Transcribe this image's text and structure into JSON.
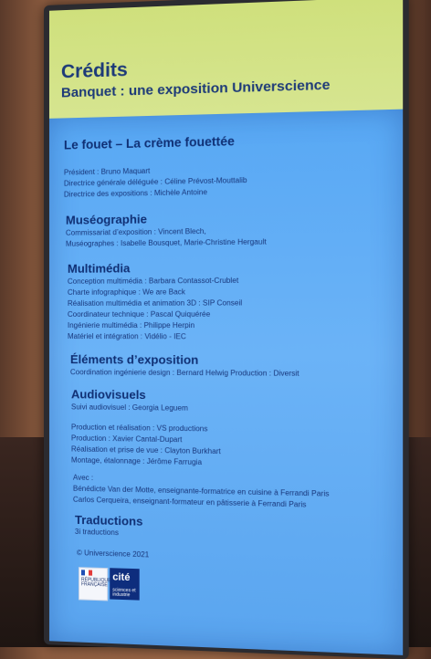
{
  "header": {
    "title": "Crédits",
    "subtitle": "Banquet : une exposition Universcience"
  },
  "main_title": "Le fouet – La crème fouettée",
  "team": [
    "Président : Bruno Maquart",
    "Directrice générale déléguée : Céline Prévost-Mouttalib",
    "Directrice des expositions : Michèle Antoine"
  ],
  "museographie": {
    "title": "Muséographie",
    "lines": [
      "Commissariat d’exposition : Vincent Blech,",
      "Muséographes : Isabelle Bousquet, Marie-Christine Hergault"
    ]
  },
  "multimedia": {
    "title": "Multimédia",
    "lines": [
      "Conception multimédia : Barbara Contassot-Crublet",
      "Charte infographique : We are Back",
      "Réalisation multimédia et animation 3D : SIP Conseil",
      "Coordinateur technique : Pascal Quiquérée",
      "Ingénierie multimédia : Philippe Herpin",
      "Matériel et intégration : Vidélio - IEC"
    ]
  },
  "elements": {
    "title": "Éléments d’exposition",
    "lines": [
      "Coordination ingénierie design : Bernard Helwig Production : Diversit"
    ]
  },
  "audiovisuels": {
    "title": "Audiovisuels",
    "lines": [
      "Suivi audiovisuel : Georgia Leguem",
      "Production et réalisation : VS productions",
      "Production : Xavier Cantal-Dupart",
      "Réalisation et prise de vue : Clayton Burkhart",
      "Montage, étalonnage : Jérôme Farrugia",
      "Avec :",
      "Bénédicte Van der Motte, enseignante-formatrice en cuisine à Ferrandi Paris",
      "Carlos Cerqueira, enseignant-formateur en pâtisserie à Ferrandi Paris"
    ]
  },
  "traductions": {
    "title": "Traductions",
    "lines": [
      "3i traductions"
    ]
  },
  "copyright": "© Universcience 2021",
  "logos": {
    "republique": "RÉPUBLIQUE FRANÇAISE",
    "cite": "cité",
    "cite_sub": "sciences et industrie"
  }
}
